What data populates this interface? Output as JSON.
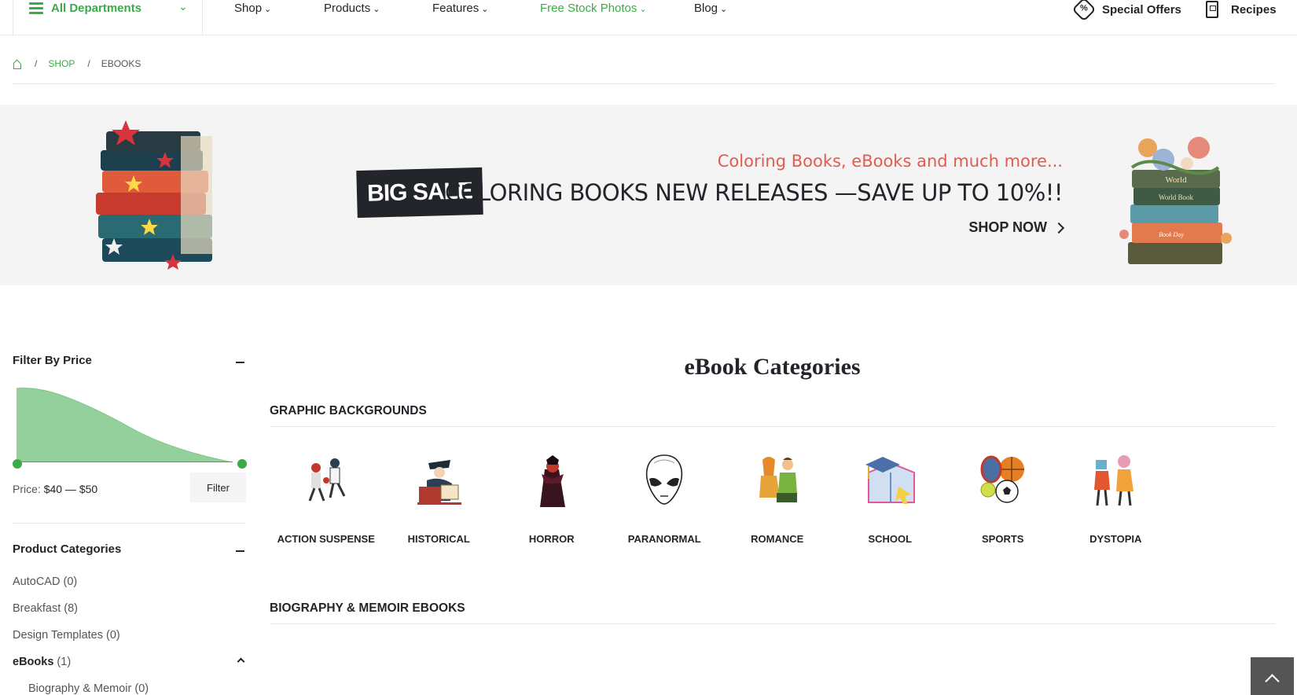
{
  "nav": {
    "all_departments": "All Departments",
    "links": [
      "Shop",
      "Products",
      "Features",
      "Free Stock Photos",
      "Blog"
    ],
    "special_offers": "Special Offers",
    "recipes": "Recipes",
    "accent_color": "#3bab4a"
  },
  "breadcrumb": {
    "shop": "SHOP",
    "current": "EBOOKS",
    "separator": "/"
  },
  "banner": {
    "subtitle": "Coloring Books, eBooks and much more...",
    "badge": "BIG SALE",
    "headline": "COLORING BOOKS NEW RELEASES —SAVE UP TO 10%!!",
    "cta": "SHOP NOW",
    "book_label_1": "World",
    "book_label_2": "World Book",
    "book_label_3": "Book Day"
  },
  "sidebar": {
    "filter_title": "Filter By Price",
    "price_label": "Price:",
    "price_value": "$40 — $50",
    "filter_button": "Filter",
    "categories_title": "Product Categories",
    "categories": [
      {
        "name": "AutoCAD",
        "count": "(0)"
      },
      {
        "name": "Breakfast",
        "count": "(8)"
      },
      {
        "name": "Design Templates",
        "count": "(0)"
      },
      {
        "name": "eBooks",
        "count": "(1)"
      }
    ],
    "subcategory": {
      "name": "Biography & Memoir",
      "count": "(0)"
    }
  },
  "main": {
    "title": "eBook Categories",
    "section1": "GRAPHIC BACKGROUNDS",
    "categories": [
      "ACTION SUSPENSE",
      "HISTORICAL",
      "HORROR",
      "PARANORMAL",
      "ROMANCE",
      "SCHOOL",
      "SPORTS",
      "DYSTOPIA"
    ],
    "section2": "BIOGRAPHY & MEMOIR EBOOKS"
  }
}
